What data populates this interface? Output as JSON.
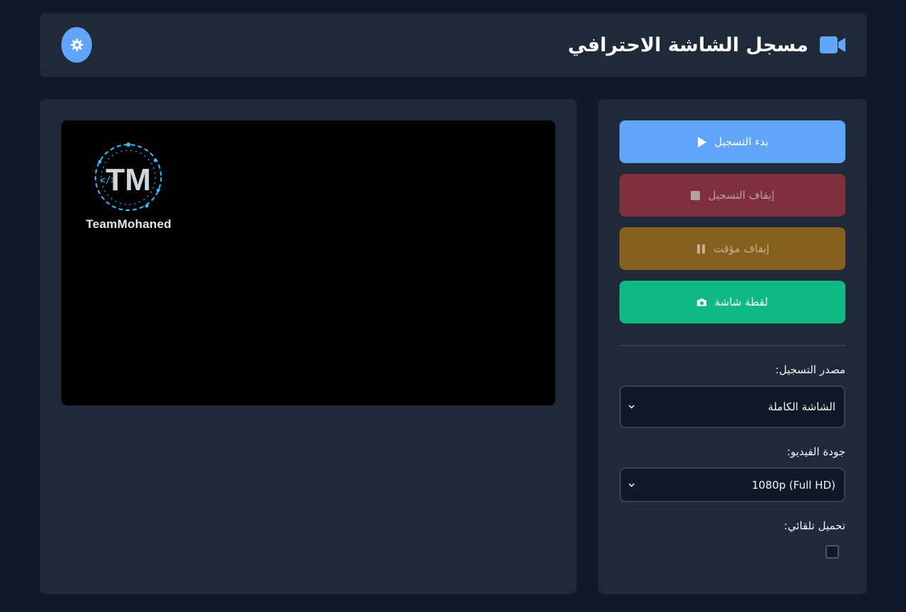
{
  "header": {
    "title": "مسجل الشاشة الاحترافي",
    "title_icon": "video-camera-icon",
    "theme_toggle_icon": "gear-icon"
  },
  "preview": {
    "logo_text": "TeamMohaned",
    "logo_letters": "TM"
  },
  "controls": {
    "start_label": "بدء التسجيل",
    "stop_label": "إيقاف التسجيل",
    "pause_label": "إيقاف مؤقت",
    "snapshot_label": "لقطة شاشة"
  },
  "settings": {
    "source_label": "مصدر التسجيل:",
    "source_value": "الشاشة الكاملة",
    "quality_label": "جودة الفيديو:",
    "quality_value": "1080p (Full HD)",
    "auto_download_label": "تحميل تلقائي:",
    "auto_download_checked": false
  },
  "colors": {
    "background": "#111827",
    "panel": "#1f2937",
    "accent": "#60a5fa",
    "stop": "#7f2f3b",
    "pause": "#86601e",
    "snapshot": "#10b981"
  }
}
